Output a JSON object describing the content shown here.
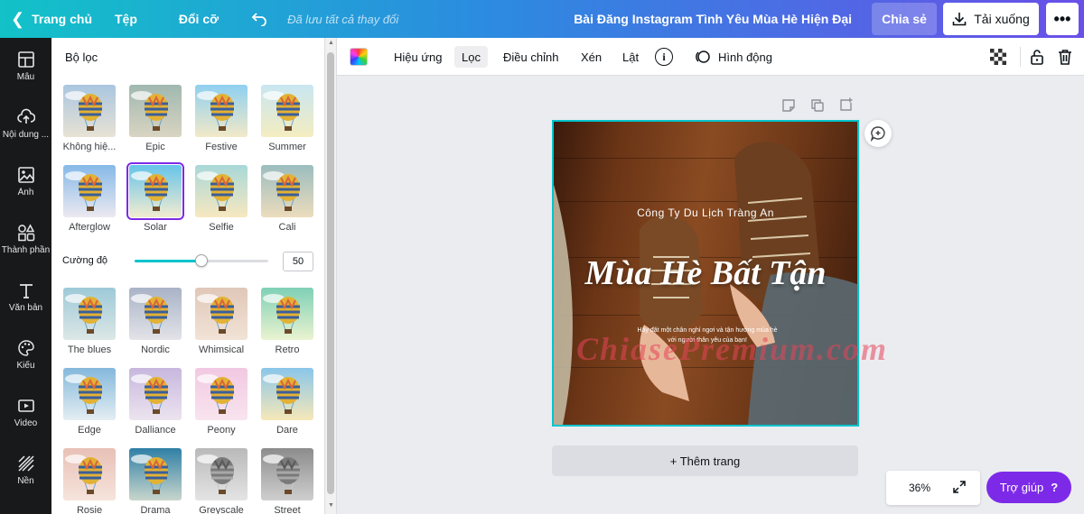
{
  "topbar": {
    "home": "Trang chủ",
    "file": "Tệp",
    "resize": "Đổi cỡ",
    "saved_status": "Đã lưu tất cả thay đổi",
    "doc_title": "Bài Đăng Instagram Tình Yêu Mùa Hè Hiện Đại",
    "share": "Chia sẻ",
    "download": "Tải xuống",
    "more": "•••"
  },
  "rail": [
    {
      "label": "Mẫu",
      "icon": "template-icon"
    },
    {
      "label": "Nội dung ...",
      "icon": "upload-icon"
    },
    {
      "label": "Ảnh",
      "icon": "photo-icon"
    },
    {
      "label": "Thành phần",
      "icon": "elements-icon"
    },
    {
      "label": "Văn bản",
      "icon": "text-icon"
    },
    {
      "label": "Kiểu",
      "icon": "palette-icon"
    },
    {
      "label": "Video",
      "icon": "video-icon"
    },
    {
      "label": "Nền",
      "icon": "background-icon"
    }
  ],
  "panel": {
    "title": "Bộ lọc",
    "intensity_label": "Cường độ",
    "intensity_value": "50",
    "intensity_fraction": 0.5,
    "filters_top": [
      {
        "label": "Không hiệ...",
        "sky": "#a9c6e0",
        "tone": "#e8e2d4"
      },
      {
        "label": "Epic",
        "sky": "#9fb8b0",
        "tone": "#d9d4c2"
      },
      {
        "label": "Festive",
        "sky": "#8fd0f0",
        "tone": "#f2e9c8"
      },
      {
        "label": "Summer",
        "sky": "#c8e6f2",
        "tone": "#f4edc0"
      },
      {
        "label": "Afterglow",
        "sky": "#86b9e8",
        "tone": "#ece9f0"
      },
      {
        "label": "Solar",
        "sky": "#66c4ea",
        "tone": "#f3ecd0",
        "selected": true
      },
      {
        "label": "Selfie",
        "sky": "#a8d8d8",
        "tone": "#f7e8c0"
      },
      {
        "label": "Cali",
        "sky": "#9bbdbf",
        "tone": "#ecdcbc"
      }
    ],
    "filters_bottom": [
      {
        "label": "The blues",
        "sky": "#9ec9d8",
        "tone": "#dce7e6"
      },
      {
        "label": "Nordic",
        "sky": "#a8b3c6",
        "tone": "#e3e3e8"
      },
      {
        "label": "Whimsical",
        "sky": "#e0c7b8",
        "tone": "#f1e3d6"
      },
      {
        "label": "Retro",
        "sky": "#7fd0b6",
        "tone": "#eaf3d0"
      },
      {
        "label": "Edge",
        "sky": "#84b8dc",
        "tone": "#e4eef2"
      },
      {
        "label": "Dalliance",
        "sky": "#c7b7de",
        "tone": "#ece4ef"
      },
      {
        "label": "Peony",
        "sky": "#f2c8e2",
        "tone": "#f8e4ee"
      },
      {
        "label": "Dare",
        "sky": "#8ac6ea",
        "tone": "#f6e8b8"
      },
      {
        "label": "Rosie",
        "sky": "#e8c0b6",
        "tone": "#f6e4dc"
      },
      {
        "label": "Drama",
        "sky": "#2f7fa6",
        "tone": "#c9d6cc"
      },
      {
        "label": "Greyscale",
        "sky": "#b9b9b9",
        "tone": "#e4e4e4",
        "grey": true
      },
      {
        "label": "Street",
        "sky": "#8c8c8c",
        "tone": "#cfcfcf",
        "grey": true
      }
    ]
  },
  "subbar": {
    "effects": "Hiệu ứng",
    "filter": "Lọc",
    "adjust": "Điều chỉnh",
    "crop": "Xén",
    "flip": "Lật",
    "info": "i",
    "animate": "Hình động"
  },
  "design": {
    "company": "Công Ty Du Lịch Tràng An",
    "title": "Mùa Hè Bất Tận",
    "body_line1": "Hãy đặt một chân nghỉ ngơi và tận hưởng mùa hè",
    "body_line2": "với người thân yêu của bạn!"
  },
  "watermark": "ChiasePremium.com",
  "canvas": {
    "add_page": "+ Thêm trang",
    "zoom": "36%",
    "help": "Trợ giúp",
    "help_icon": "?"
  },
  "colors": {
    "accent_purple": "#7d2ae8",
    "accent_teal": "#00c4cc",
    "rail_bg": "#18191b"
  }
}
